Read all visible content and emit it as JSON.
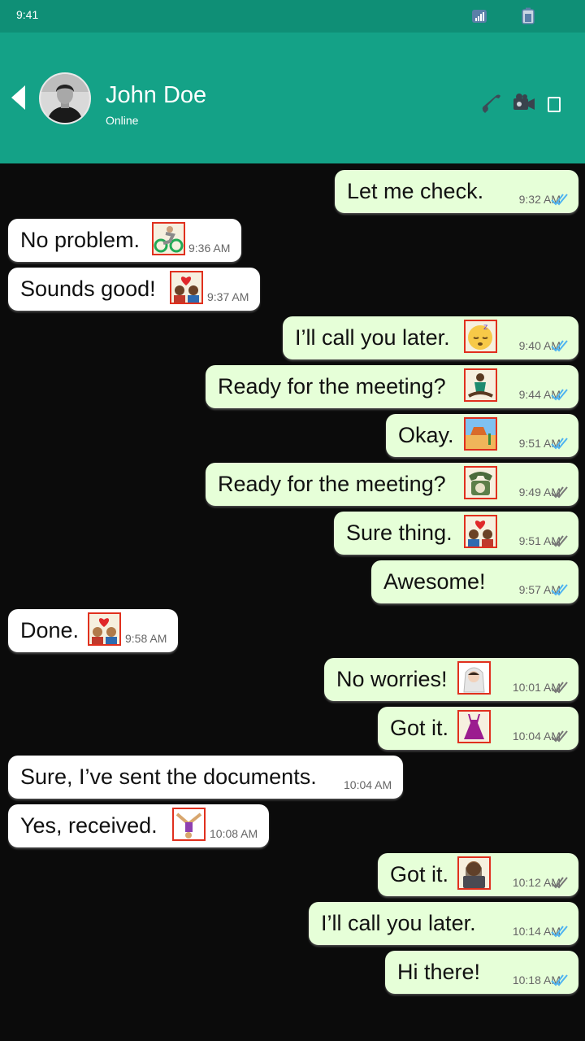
{
  "status": {
    "time": "9:41"
  },
  "contact": {
    "name": "John Doe",
    "presence": "Online"
  },
  "messages": [
    {
      "text": "Let me check.",
      "time": "9:32 AM",
      "dir": "out",
      "emoji": null
    },
    {
      "text": "No problem.",
      "time": "9:36 AM",
      "dir": "in",
      "emoji": "person-biking"
    },
    {
      "text": "Sounds good!",
      "time": "9:37 AM",
      "dir": "in",
      "emoji": "couple-with-heart"
    },
    {
      "text": "I’ll call you later.",
      "time": "9:40 AM",
      "dir": "out",
      "emoji": "sleeping-face"
    },
    {
      "text": "Ready for the meeting?",
      "time": "9:44 AM",
      "dir": "out",
      "emoji": "person-in-lotus-position"
    },
    {
      "text": "Okay.",
      "time": "9:51 AM",
      "dir": "out",
      "emoji": "desert"
    },
    {
      "text": "Ready for the meeting?",
      "time": "9:49 AM",
      "dir": "out",
      "emoji": "telephone"
    },
    {
      "text": "Sure thing.",
      "time": "9:51 AM",
      "dir": "out",
      "emoji": "couple-with-heart"
    },
    {
      "text": "Awesome!",
      "time": "9:57 AM",
      "dir": "out",
      "emoji": null
    },
    {
      "text": "Done.",
      "time": "9:58 AM",
      "dir": "in",
      "emoji": "couple-with-heart"
    },
    {
      "text": "No worries!",
      "time": "10:01 AM",
      "dir": "out",
      "emoji": "bride-with-veil"
    },
    {
      "text": "Got it.",
      "time": "10:04 AM",
      "dir": "out",
      "emoji": "dress"
    },
    {
      "text": "Sure, I’ve sent the documents.",
      "time": "10:04 AM",
      "dir": "in",
      "emoji": null
    },
    {
      "text": "Yes, received.",
      "time": "10:08 AM",
      "dir": "in",
      "emoji": "person-cartwheeling"
    },
    {
      "text": "Got it.",
      "time": "10:12 AM",
      "dir": "out",
      "emoji": "technologist"
    },
    {
      "text": "I’ll call you later.",
      "time": "10:14 AM",
      "dir": "out",
      "emoji": null
    },
    {
      "text": "Hi there!",
      "time": "10:18 AM",
      "dir": "out",
      "emoji": null
    }
  ],
  "colors": {
    "header": "#14a287",
    "statusbar": "#0f8f76",
    "outgoing": "#e6ffd8",
    "incoming": "#ffffff",
    "read_ticks": "#4fb3f0"
  }
}
